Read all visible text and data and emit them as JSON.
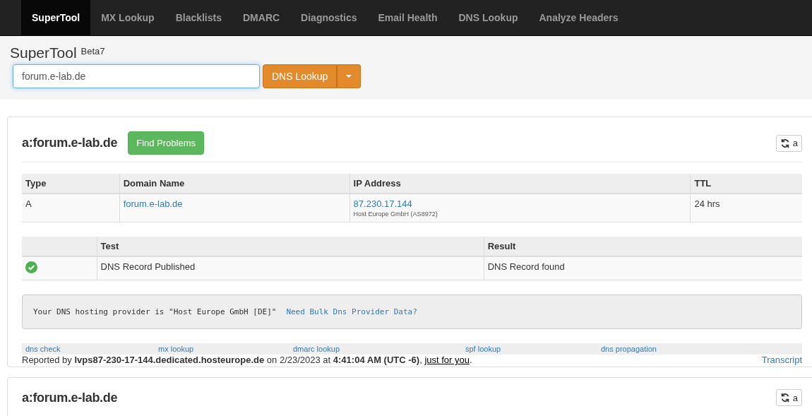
{
  "nav": [
    {
      "label": "SuperTool",
      "selected": true
    },
    {
      "label": "MX Lookup",
      "selected": false
    },
    {
      "label": "Blacklists",
      "selected": false
    },
    {
      "label": "DMARC",
      "selected": false
    },
    {
      "label": "Diagnostics",
      "selected": false
    },
    {
      "label": "Email Health",
      "selected": false
    },
    {
      "label": "DNS Lookup",
      "selected": false
    },
    {
      "label": "Analyze Headers",
      "selected": false
    }
  ],
  "header": {
    "title": "SuperTool",
    "badge": "Beta7",
    "search_value": "forum.e-lab.de",
    "action": "DNS Lookup"
  },
  "results": [
    {
      "title": "a:forum.e-lab.de",
      "find_button": "Find Problems",
      "refresh_label": "a",
      "records": {
        "columns": [
          "Type",
          "Domain Name",
          "IP Address",
          "TTL"
        ],
        "rows": [
          {
            "type": "A",
            "domain": "forum.e-lab.de",
            "ip": "87.230.17.144",
            "ip_note": "Host Europe GmbH  (AS8972)",
            "ttl": "24 hrs"
          }
        ]
      },
      "tests": {
        "columns": [
          "Test",
          "Result"
        ],
        "rows": [
          {
            "passed": true,
            "test": "DNS Record Published",
            "result": "DNS Record found"
          }
        ]
      },
      "notice": {
        "text": "Your DNS hosting provider is \"Host Europe GmbH [DE]\"",
        "link": "Need Bulk Dns Provider Data?"
      },
      "links": [
        "dns check",
        "mx lookup",
        "dmarc lookup",
        "spf lookup",
        "dns propagation"
      ],
      "report": {
        "before": "Reported by **lvps87-230-17-144.dedicated.hosteurope.de** on 2/23/2023 at **4:41:04 AM (UTC -6)**, ",
        "link": "just for you",
        "after": ".",
        "transcript": "Transcript"
      }
    },
    {
      "title": "a:forum.e-lab.de",
      "refresh_label": "a"
    }
  ]
}
